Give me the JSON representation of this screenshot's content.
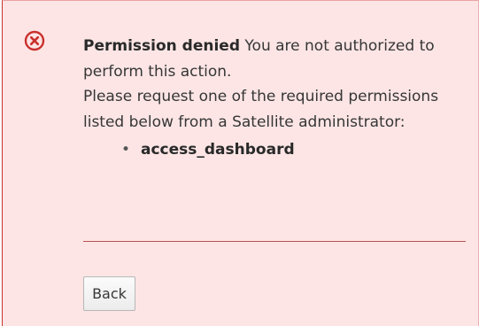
{
  "alert": {
    "icon": "error-circle-icon",
    "title": "Permission denied",
    "message_1": "You are not authorized to perform this action.",
    "message_2": "Please request one of the required permissions listed below from a Satellite administrator:",
    "permissions": [
      {
        "name": "access_dashboard"
      }
    ],
    "bullet": "•"
  },
  "actions": {
    "back_label": "Back"
  },
  "colors": {
    "alert_background": "#fde5e5",
    "danger": "#c9302c",
    "text": "#363636"
  }
}
